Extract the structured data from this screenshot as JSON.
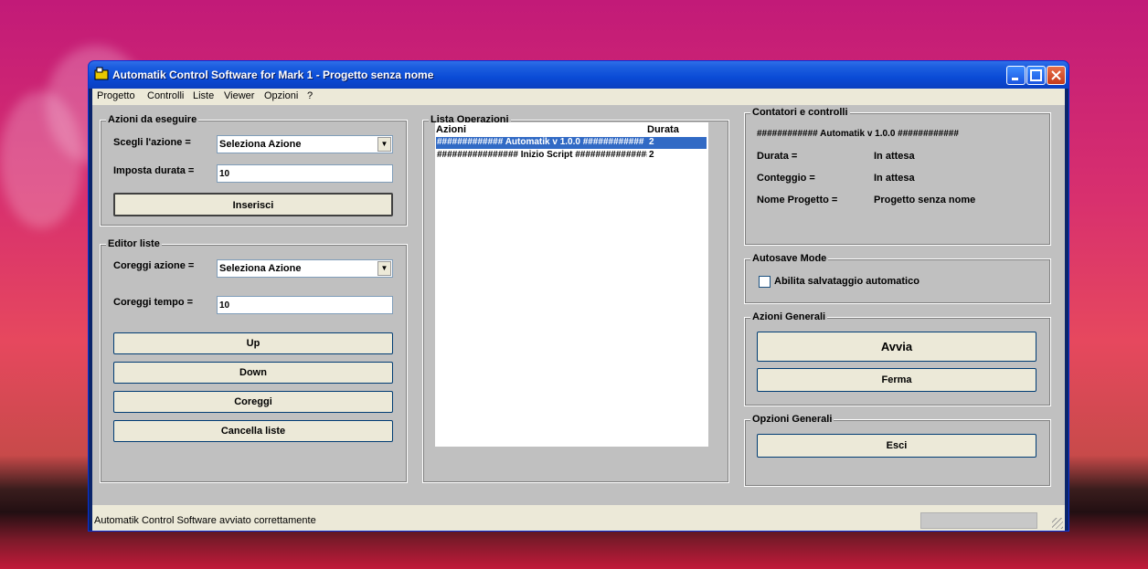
{
  "window": {
    "title": "Automatik Control Software for Mark 1 - Progetto senza nome"
  },
  "menu": [
    "Progetto",
    "Controlli",
    "Liste",
    "Viewer",
    "Opzioni",
    "?"
  ],
  "azioni": {
    "title": "Azioni da eseguire",
    "scegli_label": "Scegli l'azione =",
    "scegli_value": "Seleziona Azione",
    "durata_label": "Imposta durata =",
    "durata_value": "10",
    "inserisci": "Inserisci"
  },
  "editor": {
    "title": "Editor liste",
    "coreggi_azione_label": "Coreggi azione  =",
    "coreggi_azione_value": "Seleziona Azione",
    "coreggi_tempo_label": "Coreggi tempo  =",
    "coreggi_tempo_value": "10",
    "up": "Up",
    "down": "Down",
    "coreggi": "Coreggi",
    "cancella": "Cancella liste"
  },
  "lista": {
    "title": "Lista Operazioni",
    "col_azioni": "Azioni",
    "col_durata": "Durata",
    "rows": [
      {
        "azione": "############# Automatik v 1.0.0 ############",
        "durata": "2"
      },
      {
        "azione": "################ Inizio Script ###############",
        "durata": "2"
      }
    ]
  },
  "contatori": {
    "title": "Contatori e controlli",
    "header": "############ Automatik v 1.0.0 ############",
    "durata_label": "Durata =",
    "durata_value": "In attesa",
    "conteggio_label": "Conteggio =",
    "conteggio_value": "In attesa",
    "nome_label": "Nome Progetto =",
    "nome_value": "Progetto senza nome"
  },
  "autosave": {
    "title": "Autosave Mode",
    "checkbox_label": "Abilita salvataggio automatico",
    "checked": false
  },
  "azioni_generali": {
    "title": "Azioni Generali",
    "avvia": "Avvia",
    "ferma": "Ferma"
  },
  "opzioni_generali": {
    "title": "Opzioni Generali",
    "esci": "Esci"
  },
  "status": {
    "text": "Automatik Control Software avviato correttamente"
  }
}
